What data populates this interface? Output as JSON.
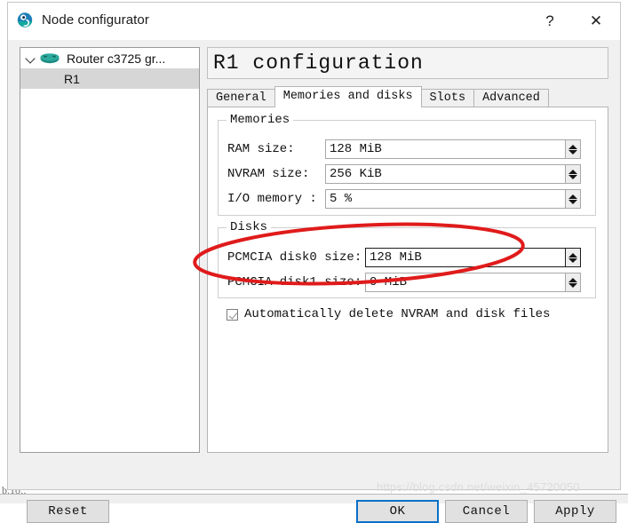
{
  "window": {
    "title": "Node configurator",
    "app_icon": "gns3-icon",
    "help_label": "?",
    "close_label": "✕"
  },
  "tree": {
    "nodes": [
      {
        "label": "Router c3725 gr...",
        "icon": "router-icon",
        "expanded": true
      },
      {
        "label": "R1",
        "selected": true
      }
    ]
  },
  "config": {
    "heading": "R1 configuration",
    "tabs": [
      {
        "label": "General",
        "active": false
      },
      {
        "label": "Memories and disks",
        "active": true
      },
      {
        "label": "Slots",
        "active": false
      },
      {
        "label": "Advanced",
        "active": false
      }
    ],
    "memories": {
      "group_title": "Memories",
      "fields": [
        {
          "label": "RAM size:",
          "value": "128 MiB",
          "focused": false
        },
        {
          "label": "NVRAM size:",
          "value": "256 KiB",
          "focused": false
        },
        {
          "label": "I/O memory :",
          "value": "5 %",
          "focused": false
        }
      ]
    },
    "disks": {
      "group_title": "Disks",
      "fields": [
        {
          "label": "PCMCIA disk0 size:",
          "value": "128 MiB",
          "focused": true
        },
        {
          "label": "PCMCIA disk1 size:",
          "value": "0 MiB",
          "focused": false
        }
      ]
    },
    "auto_delete": {
      "label": "Automatically delete NVRAM and disk files",
      "checked": true
    }
  },
  "buttons": {
    "reset": "Reset",
    "ok": "OK",
    "cancel": "Cancel",
    "apply": "Apply"
  },
  "annotation": {
    "shape": "ellipse",
    "color": "#e01b1b"
  },
  "watermark": "https://blog.csdn.net/weixin_45720050",
  "backdrop_text": "b.1o;."
}
